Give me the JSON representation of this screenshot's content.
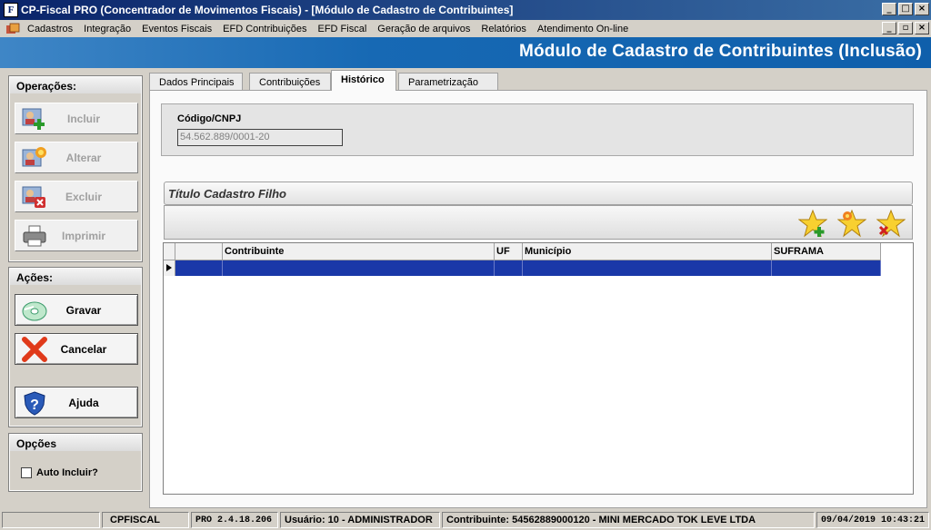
{
  "window": {
    "title": "CP-Fiscal PRO (Concentrador de Movimentos Fiscais) - [Módulo de Cadastro de Contribuintes]"
  },
  "menu": [
    "Cadastros",
    "Integração",
    "Eventos Fiscais",
    "EFD Contribuições",
    "EFD Fiscal",
    "Geração de arquivos",
    "Relatórios",
    "Atendimento On-line"
  ],
  "banner": {
    "title": "Módulo de Cadastro de Contribuintes (Inclusão)"
  },
  "sidebar": {
    "operacoes": {
      "title": "Operações:",
      "buttons": [
        {
          "label": "Incluir",
          "icon": "add-user-icon",
          "enabled": false
        },
        {
          "label": "Alterar",
          "icon": "edit-user-icon",
          "enabled": false
        },
        {
          "label": "Excluir",
          "icon": "delete-user-icon",
          "enabled": false
        },
        {
          "label": "Imprimir",
          "icon": "printer-icon",
          "enabled": false
        }
      ]
    },
    "acoes": {
      "title": "Ações:",
      "buttons": [
        {
          "label": "Gravar",
          "icon": "save-disk-icon"
        },
        {
          "label": "Cancelar",
          "icon": "cancel-x-icon"
        },
        {
          "label": "Ajuda",
          "icon": "help-shield-icon"
        }
      ]
    },
    "opcoes": {
      "title": "Opções",
      "auto_incluir_label": "Auto Incluir?",
      "auto_incluir_checked": false
    }
  },
  "tabs": [
    "Dados Principais",
    "Contribuições",
    "Histórico",
    "Parametrização"
  ],
  "active_tab": "Histórico",
  "codigo": {
    "label": "Código/CNPJ",
    "value": "54.562.889/0001-20"
  },
  "filho": {
    "title": "Título Cadastro Filho",
    "toolbar_icons": [
      "star-add-icon",
      "star-edit-icon",
      "star-delete-icon"
    ]
  },
  "grid": {
    "columns": [
      "",
      "Contribuinte",
      "UF",
      "Município",
      "SUFRAMA"
    ],
    "rows": [
      [
        "",
        "",
        "",
        "",
        ""
      ]
    ]
  },
  "status": {
    "app": "CPFISCAL",
    "version": "PRO 2.4.18.206",
    "usuario": "Usuário: 10 - ADMINISTRADOR",
    "contribuinte": "Contribuinte: 54562889000120 - MINI MERCADO TOK LEVE LTDA",
    "datetime": "09/04/2019 10:43:21"
  },
  "colors": {
    "banner": "#1769b4",
    "titlebar": "#0a246a",
    "grid_selected": "#1a38a8"
  }
}
